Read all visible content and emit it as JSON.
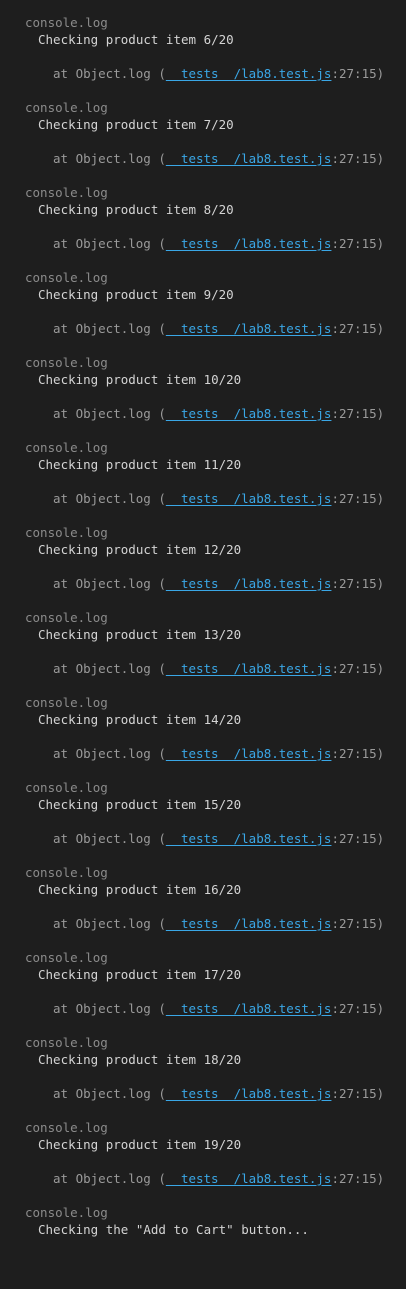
{
  "entries": [
    {
      "tag": "console.log",
      "message": "Checking product item 6/20",
      "trace_prefix": "at Object.log (",
      "trace_file": "__tests__/lab8.test.js",
      "trace_loc": ":27:15)"
    },
    {
      "tag": "console.log",
      "message": "Checking product item 7/20",
      "trace_prefix": "at Object.log (",
      "trace_file": "__tests__/lab8.test.js",
      "trace_loc": ":27:15)"
    },
    {
      "tag": "console.log",
      "message": "Checking product item 8/20",
      "trace_prefix": "at Object.log (",
      "trace_file": "__tests__/lab8.test.js",
      "trace_loc": ":27:15)"
    },
    {
      "tag": "console.log",
      "message": "Checking product item 9/20",
      "trace_prefix": "at Object.log (",
      "trace_file": "__tests__/lab8.test.js",
      "trace_loc": ":27:15)"
    },
    {
      "tag": "console.log",
      "message": "Checking product item 10/20",
      "trace_prefix": "at Object.log (",
      "trace_file": "__tests__/lab8.test.js",
      "trace_loc": ":27:15)"
    },
    {
      "tag": "console.log",
      "message": "Checking product item 11/20",
      "trace_prefix": "at Object.log (",
      "trace_file": "__tests__/lab8.test.js",
      "trace_loc": ":27:15)"
    },
    {
      "tag": "console.log",
      "message": "Checking product item 12/20",
      "trace_prefix": "at Object.log (",
      "trace_file": "__tests__/lab8.test.js",
      "trace_loc": ":27:15)"
    },
    {
      "tag": "console.log",
      "message": "Checking product item 13/20",
      "trace_prefix": "at Object.log (",
      "trace_file": "__tests__/lab8.test.js",
      "trace_loc": ":27:15)"
    },
    {
      "tag": "console.log",
      "message": "Checking product item 14/20",
      "trace_prefix": "at Object.log (",
      "trace_file": "__tests__/lab8.test.js",
      "trace_loc": ":27:15)"
    },
    {
      "tag": "console.log",
      "message": "Checking product item 15/20",
      "trace_prefix": "at Object.log (",
      "trace_file": "__tests__/lab8.test.js",
      "trace_loc": ":27:15)"
    },
    {
      "tag": "console.log",
      "message": "Checking product item 16/20",
      "trace_prefix": "at Object.log (",
      "trace_file": "__tests__/lab8.test.js",
      "trace_loc": ":27:15)"
    },
    {
      "tag": "console.log",
      "message": "Checking product item 17/20",
      "trace_prefix": "at Object.log (",
      "trace_file": "__tests__/lab8.test.js",
      "trace_loc": ":27:15)"
    },
    {
      "tag": "console.log",
      "message": "Checking product item 18/20",
      "trace_prefix": "at Object.log (",
      "trace_file": "__tests__/lab8.test.js",
      "trace_loc": ":27:15)"
    },
    {
      "tag": "console.log",
      "message": "Checking product item 19/20",
      "trace_prefix": "at Object.log (",
      "trace_file": "__tests__/lab8.test.js",
      "trace_loc": ":27:15)"
    },
    {
      "tag": "console.log",
      "message": "Checking the \"Add to Cart\" button...",
      "trace_prefix": "",
      "trace_file": "",
      "trace_loc": ""
    }
  ]
}
